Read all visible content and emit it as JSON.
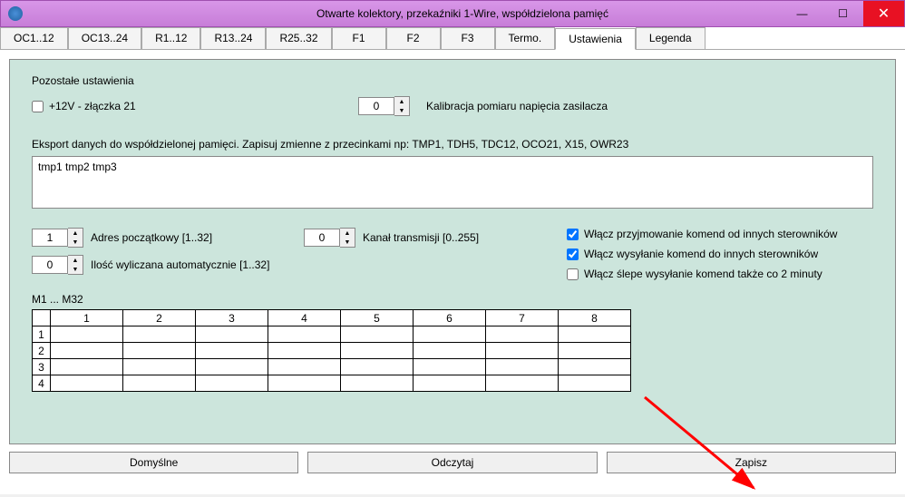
{
  "window": {
    "title": "Otwarte kolektory, przekaźniki 1-Wire, współdzielona pamięć"
  },
  "tabs": [
    {
      "label": "OC1..12"
    },
    {
      "label": "OC13..24"
    },
    {
      "label": "R1..12"
    },
    {
      "label": "R13..24"
    },
    {
      "label": "R25..32"
    },
    {
      "label": "F1"
    },
    {
      "label": "F2"
    },
    {
      "label": "F3"
    },
    {
      "label": "Termo."
    },
    {
      "label": "Ustawienia"
    },
    {
      "label": "Legenda"
    }
  ],
  "active_tab": 9,
  "settings": {
    "section_title": "Pozostałe ustawienia",
    "checkbox12v_label": "+12V - złączka 21",
    "checkbox12v_checked": false,
    "calibration_value": "0",
    "calibration_label": "Kalibracja pomiaru napięcia zasilacza",
    "export_label": "Eksport danych do współdzielonej pamięci. Zapisuj zmienne z przecinkami np: TMP1, TDH5, TDC12, OCO21, X15, OWR23",
    "export_value": "tmp1 tmp2 tmp3",
    "addr_start_value": "1",
    "addr_start_label": "Adres początkowy [1..32]",
    "channel_value": "0",
    "channel_label": "Kanał transmisji [0..255]",
    "auto_count_value": "0",
    "auto_count_label": "Ilość wyliczana automatycznie [1..32]",
    "cb_receive_label": "Włącz przyjmowanie komend od innych sterowników",
    "cb_receive_checked": true,
    "cb_send_label": "Włącz wysyłanie komend do innych sterowników",
    "cb_send_checked": true,
    "cb_blind_label": "Włącz ślepe wysyłanie komend także co 2 minuty",
    "cb_blind_checked": false,
    "m_label": "M1 ... M32",
    "grid_cols": [
      "1",
      "2",
      "3",
      "4",
      "5",
      "6",
      "7",
      "8"
    ],
    "grid_rows": [
      "1",
      "2",
      "3",
      "4"
    ]
  },
  "buttons": {
    "defaults": "Domyślne",
    "read": "Odczytaj",
    "save": "Zapisz"
  }
}
